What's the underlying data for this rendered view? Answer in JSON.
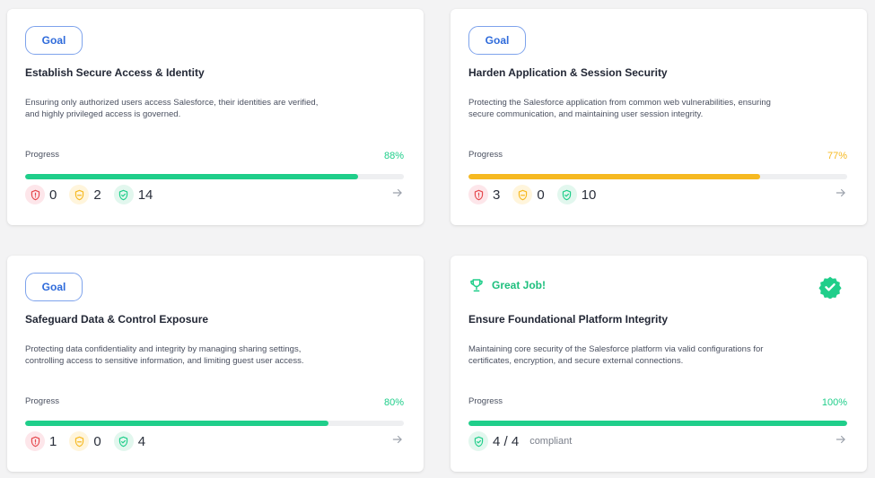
{
  "colors": {
    "green": "#1fce8a",
    "amber": "#f6b921",
    "red": "#e5484d",
    "blue": "#2f6bdb"
  },
  "cards": [
    {
      "badge": "Goal",
      "title": "Establish Secure Access & Identity",
      "description": "Ensuring only authorized users access Salesforce, their identities are verified, and highly privileged access is governed.",
      "progress_label": "Progress",
      "progress_text": "88%",
      "progress": 88,
      "progress_color": "#1fce8a",
      "stats": {
        "critical": "0",
        "warning": "2",
        "compliant": "14"
      },
      "arrow_icon": "arrow-right-icon"
    },
    {
      "badge": "Goal",
      "title": "Harden Application & Session Security",
      "description": "Protecting the Salesforce application from common web vulnerabilities, ensuring secure communication, and maintaining user session integrity.",
      "progress_label": "Progress",
      "progress_text": "77%",
      "progress": 77,
      "progress_color": "#f6b921",
      "stats": {
        "critical": "3",
        "warning": "0",
        "compliant": "10"
      },
      "arrow_icon": "arrow-right-icon"
    },
    {
      "badge": "Goal",
      "title": "Safeguard Data & Control Exposure",
      "description": "Protecting data confidentiality and integrity by managing sharing settings, controlling access to sensitive information, and limiting guest user access.",
      "progress_label": "Progress",
      "progress_text": "80%",
      "progress": 80,
      "progress_color": "#1fce8a",
      "stats": {
        "critical": "1",
        "warning": "0",
        "compliant": "4"
      },
      "arrow_icon": "arrow-right-icon"
    },
    {
      "status_label": "Great Job!",
      "status_icon": "trophy-icon",
      "verified_icon": "verified-badge-icon",
      "title": "Ensure Foundational Platform Integrity",
      "description": "Maintaining core security of the Salesforce platform via valid configurations for certificates, encryption, and secure external connections.",
      "progress_label": "Progress",
      "progress_text": "100%",
      "progress": 100,
      "progress_color": "#1fce8a",
      "stats": {
        "compliant_ratio": "4 / 4",
        "compliant_suffix": "compliant"
      },
      "arrow_icon": "arrow-right-icon"
    }
  ]
}
